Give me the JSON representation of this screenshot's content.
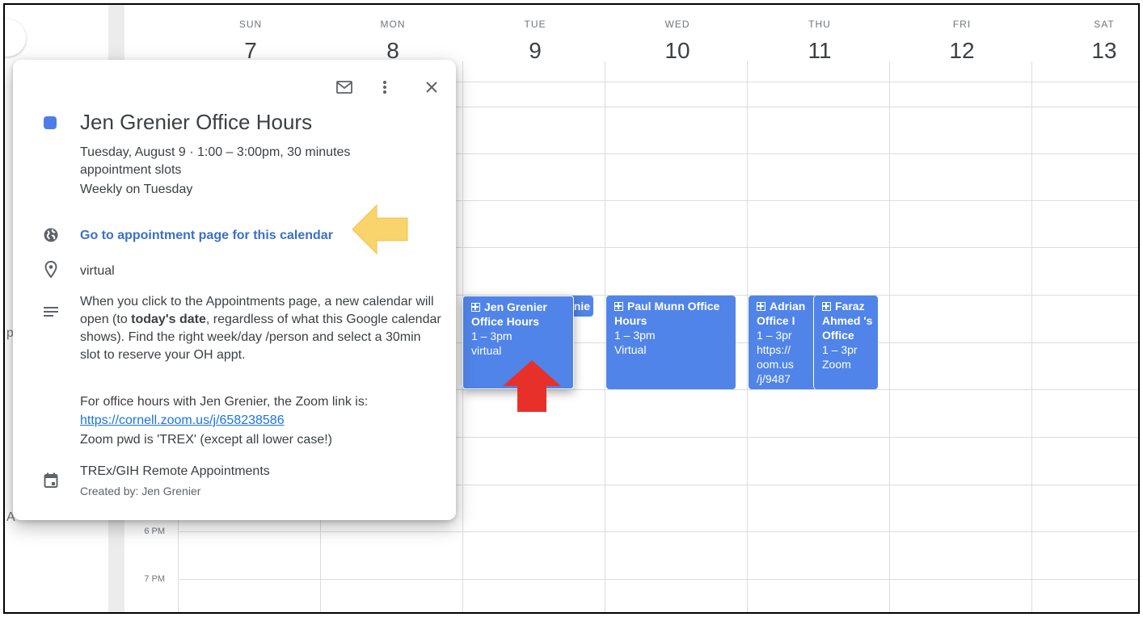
{
  "header": {
    "days": [
      {
        "name": "SUN",
        "num": "7"
      },
      {
        "name": "MON",
        "num": "8"
      },
      {
        "name": "TUE",
        "num": "9"
      },
      {
        "name": "WED",
        "num": "10"
      },
      {
        "name": "THU",
        "num": "11"
      },
      {
        "name": "FRI",
        "num": "12"
      },
      {
        "name": "SAT",
        "num": "13"
      }
    ]
  },
  "gutter": {
    "times": [
      "6 PM",
      "7 PM"
    ],
    "stub_p": "p",
    "stub_a": "A"
  },
  "events": {
    "jen": {
      "title": "Jen Grenier Office Hours",
      "time": "1 – 3pm",
      "location": "virtual"
    },
    "jen_behind": {
      "title": "enie"
    },
    "paul": {
      "title": "Paul Munn Office Hours",
      "time": "1 – 3pm",
      "location": "Virtual"
    },
    "adrian": {
      "title": "Adrian Office I",
      "time": "1 – 3pr",
      "location": "https:// oom.us /j/9487"
    },
    "faraz": {
      "title": "Faraz Ahmed 's Office",
      "time": "1 – 3pr",
      "location": "Zoom"
    }
  },
  "popup": {
    "title": "Jen Grenier Office Hours",
    "date_line": "Tuesday, August 9  ·  1:00 – 3:00pm, 30 minutes",
    "date_line2": "appointment slots",
    "recurrence": "Weekly on Tuesday",
    "appointment_link": "Go to appointment page for this calendar",
    "location": "virtual",
    "desc_pre": "When you click to the Appointments page, a new calendar will open (to ",
    "desc_bold": "today's date",
    "desc_post": ", regardless of what this Google calendar shows). Find the right week/day /person and select a 30min slot to reserve your OH appt.",
    "zoom_intro": "For office hours with Jen Grenier, the Zoom link is:",
    "zoom_url": "https://cornell.zoom.us/j/658238586",
    "zoom_pwd": "Zoom pwd is 'TREX' (except all lower case!)",
    "calendar_name": "TREx/GIH Remote Appointments",
    "created_by": "Created by: Jen Grenier"
  },
  "colors": {
    "event_blue": "#5084e8",
    "annotation_yellow": "#f9d46c",
    "annotation_red": "#e8302a"
  },
  "icons": [
    "email-icon",
    "more-vert-icon",
    "close-icon",
    "globe-icon",
    "location-pin-icon",
    "description-icon",
    "calendar-icon"
  ]
}
